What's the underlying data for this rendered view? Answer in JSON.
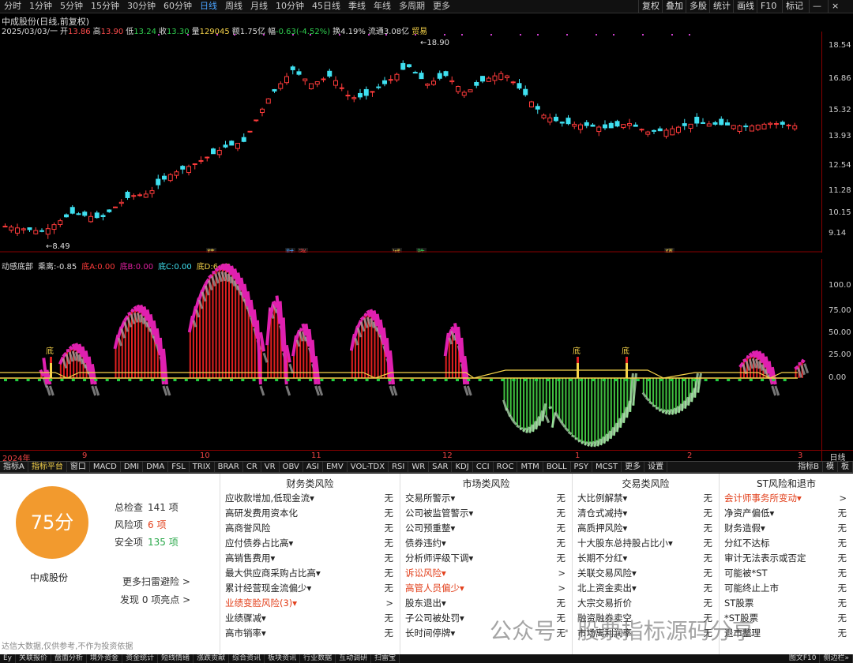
{
  "topbar": {
    "periods": [
      "分时",
      "1分钟",
      "5分钟",
      "15分钟",
      "30分钟",
      "60分钟",
      "日线",
      "周线",
      "月线",
      "10分钟",
      "45日线",
      "季线",
      "年线",
      "多周期",
      "更多"
    ],
    "active": "日线",
    "right": [
      "复权",
      "叠加",
      "多股",
      "统计",
      "画线",
      "F10",
      "标记"
    ]
  },
  "quote": {
    "title": "中成股份(日线,前复权)",
    "date": "2025/03/03/一",
    "open_label": "开",
    "open": "13.86",
    "high_label": "高",
    "high": "13.90",
    "low_label": "低",
    "low": "13.24",
    "close_label": "收",
    "close": "13.30",
    "vol_label": "量",
    "vol": "129045",
    "amt_label": "额",
    "amt": "1.75亿",
    "chg_label": "幅",
    "chg": "-0.63(-4.52%)",
    "turn_label": "换",
    "turn": "4.19%",
    "float_label": "流通",
    "float": "3.08亿",
    "trade": "贸易"
  },
  "price_axis": [
    "18.54",
    "16.86",
    "15.32",
    "13.93",
    "12.54",
    "11.28",
    "10.15",
    "9.14"
  ],
  "price_marks": {
    "high": "18.90",
    "low": "8.49"
  },
  "event_labels": [
    "精",
    "财",
    "涨",
    "减",
    "跌",
    "预"
  ],
  "indicator": {
    "name": "动感底部",
    "k_label": "乘离:",
    "k": "-0.85",
    "a_label": "底A:",
    "a": "0.00",
    "b_label": "底B:",
    "b": "0.00",
    "c_label": "底C:",
    "c": "0.00",
    "d_label": "底D:",
    "d": "6.00",
    "axis": [
      "100.0",
      "75.00",
      "50.00",
      "25.00",
      "0.00"
    ],
    "markers": [
      "底",
      "底",
      "底"
    ]
  },
  "xaxis": [
    "2024年",
    "9",
    "10",
    "11",
    "12",
    "1",
    "2",
    "3"
  ],
  "xaxis_right": "日线",
  "tabs": [
    "指标A",
    "指标平台",
    "窗口",
    "MACD",
    "DMI",
    "DMA",
    "FSL",
    "TRIX",
    "BRAR",
    "CR",
    "VR",
    "OBV",
    "ASI",
    "EMV",
    "VOL-TDX",
    "RSI",
    "WR",
    "SAR",
    "KDJ",
    "CCI",
    "ROC",
    "MTM",
    "BOLL",
    "PSY",
    "MCST",
    "更多",
    "设置"
  ],
  "tabs_right": [
    "指标B",
    "模",
    "板"
  ],
  "risk": {
    "score": "75分",
    "stock": "中成股份",
    "total_label": "总检查",
    "total": "141 项",
    "risk_label": "风险项",
    "risk": "6 项",
    "safe_label": "安全项",
    "safe": "135 项",
    "more": "更多扫雷避险 >",
    "find": "发现 0 项亮点 >"
  },
  "columns": [
    {
      "title": "财务类风险",
      "rows": [
        [
          "应收款增加,低现金流▾",
          "无"
        ],
        [
          "高研发费用资本化",
          "无"
        ],
        [
          "高商誉风险",
          "无"
        ],
        [
          "应付债券占比高▾",
          "无"
        ],
        [
          "高销售费用▾",
          "无"
        ],
        [
          "最大供应商采购占比高▾",
          "无"
        ],
        [
          "累计经营现金流偏少▾",
          "无"
        ],
        [
          "业绩变脸风险(3)▾",
          ">"
        ],
        [
          "业绩骤减▾",
          "无"
        ],
        [
          "高市销率▾",
          "无"
        ]
      ]
    },
    {
      "title": "市场类风险",
      "rows": [
        [
          "交易所警示▾",
          "无"
        ],
        [
          "公司被监管警示▾",
          "无"
        ],
        [
          "公司预重整▾",
          "无"
        ],
        [
          "债券违约▾",
          "无"
        ],
        [
          "分析师评级下调▾",
          "无"
        ],
        [
          "诉讼风险▾",
          ">"
        ],
        [
          "高管人员偏少▾",
          ">"
        ],
        [
          "股东退出▾",
          "无"
        ],
        [
          "子公司被处罚▾",
          "无"
        ],
        [
          "长时间停牌▾",
          "无"
        ]
      ]
    },
    {
      "title": "交易类风险",
      "rows": [
        [
          "大比例解禁▾",
          "无"
        ],
        [
          "清仓式减持▾",
          "无"
        ],
        [
          "高质押风险▾",
          "无"
        ],
        [
          "十大股东总持股占比小▾",
          "无"
        ],
        [
          "长期不分红▾",
          "无"
        ],
        [
          "关联交易风险▾",
          "无"
        ],
        [
          "北上资金卖出▾",
          "无"
        ],
        [
          "大宗交易折价",
          "无"
        ],
        [
          "融资融券卖空",
          "无"
        ],
        [
          "市场离利润率",
          "无"
        ]
      ]
    },
    {
      "title": "ST风险和退市",
      "rows": [
        [
          "会计师事务所变动▾",
          ">"
        ],
        [
          "净资产偏低▾",
          "无"
        ],
        [
          "财务造假▾",
          "无"
        ],
        [
          "分红不达标",
          "无"
        ],
        [
          "审计无法表示或否定",
          "无"
        ],
        [
          "可能被*ST",
          "无"
        ],
        [
          "可能终止上市",
          "无"
        ],
        [
          "ST股票",
          "无"
        ],
        [
          "*ST股票",
          "无"
        ],
        [
          "退市整理",
          "无"
        ]
      ]
    }
  ],
  "disclaimer": "达信大数据,仅供参考,不作为投资依据",
  "footer": [
    "Ey",
    "关联报价",
    "盘面分析",
    "境外资金",
    "资金统计",
    "短线情绪",
    "涨跌贡献",
    "综合资讯",
    "板块资讯",
    "行业数据",
    "互动调研",
    "扫雷宝"
  ],
  "footer_right": [
    "图文F10",
    "侧边栏»"
  ],
  "watermark": "公众号 · 股票指标源码分享",
  "colors": {
    "up": "#ff3b3b",
    "down": "#3fe0f0",
    "accent": "#4aa3ff",
    "score": "#f29a2e",
    "risk": "#e2401c"
  }
}
